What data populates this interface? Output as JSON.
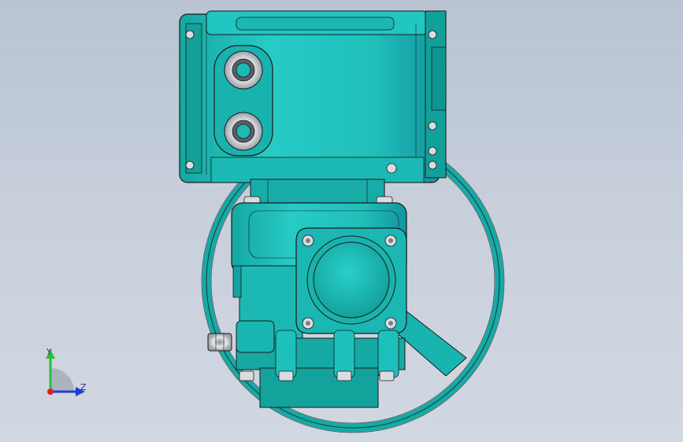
{
  "viewport": {
    "background_top": "#b9c3d2",
    "background_bottom": "#d2d8e2"
  },
  "model": {
    "body_color": "#1fc0bb",
    "body_shadow": "#0f8f8a",
    "edge_color": "#1a1a1a",
    "bolt_color": "#d9dde2"
  },
  "triad": {
    "y_label": "Y",
    "z_label": "Z",
    "y_color": "#2bbf3a",
    "z_color": "#1e3fcf",
    "origin_color": "#e02020"
  }
}
